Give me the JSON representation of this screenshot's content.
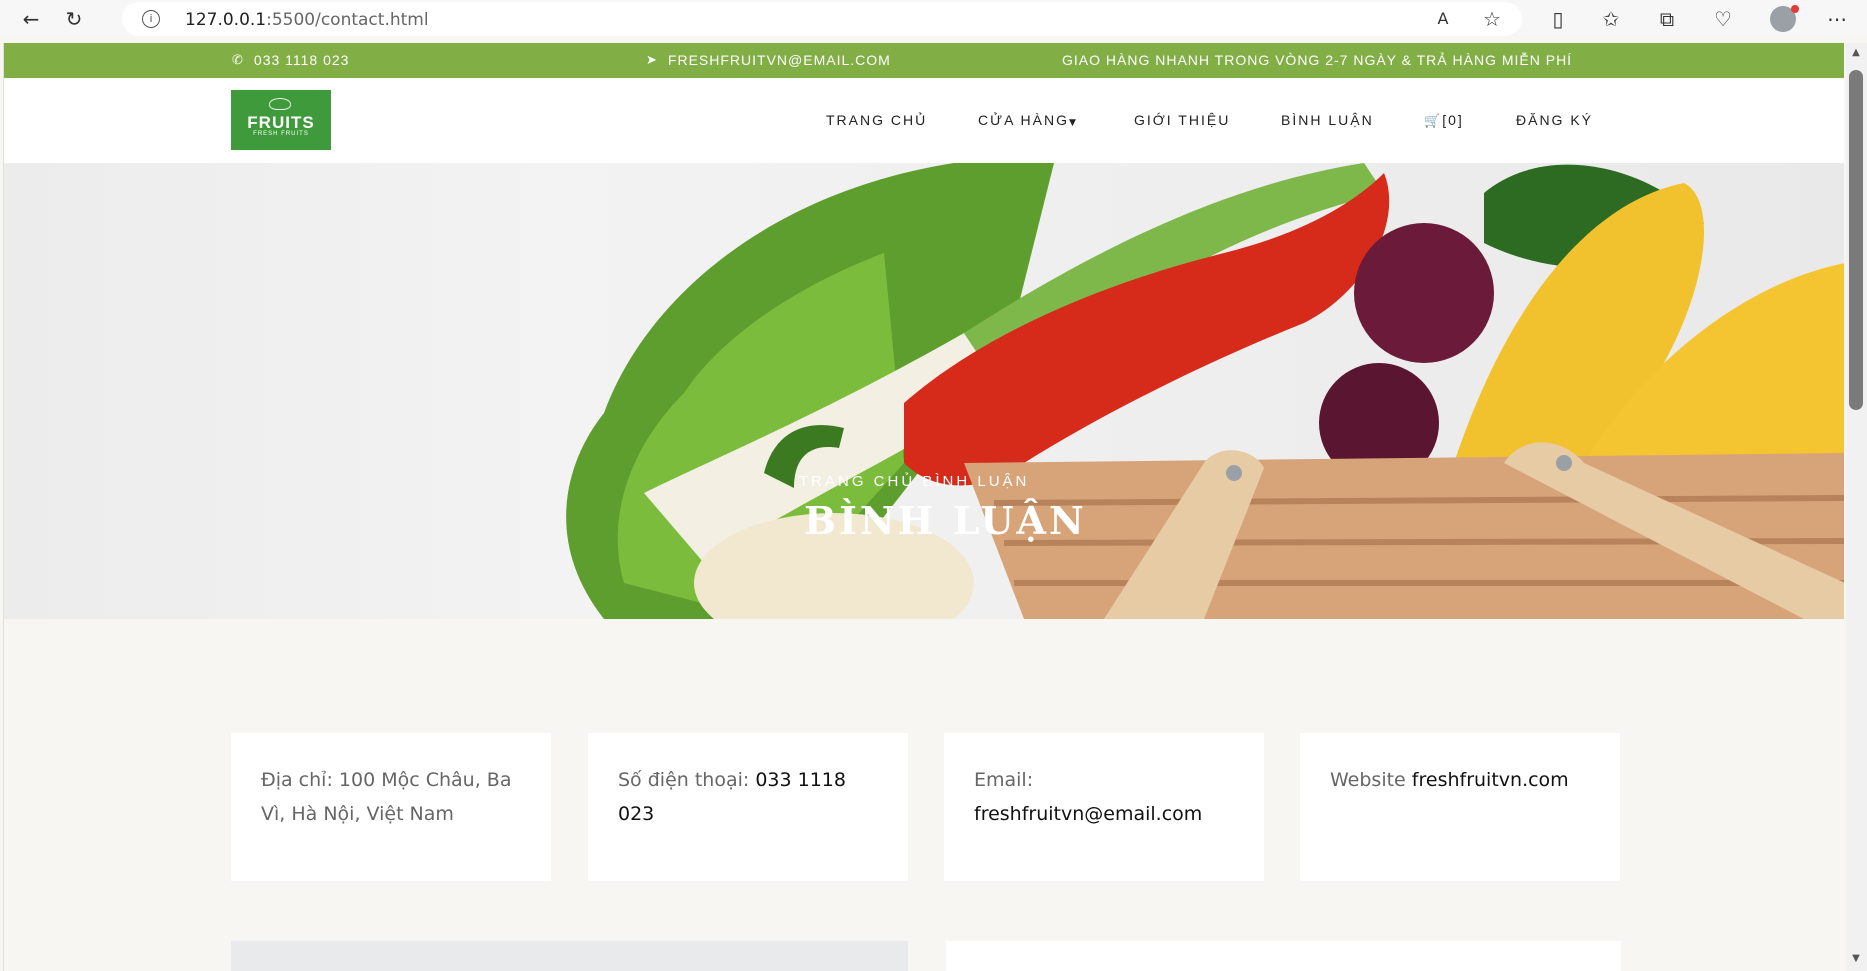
{
  "browser": {
    "url_host": "127.0.0.1",
    "url_rest": ":5500/contact.html"
  },
  "topbar": {
    "phone": "033 1118 023",
    "email": "FRESHFRUITVN@EMAIL.COM",
    "shipping": "GIAO HÀNG NHANH TRONG VÒNG 2-7 NGÀY & TRẢ HÀNG MIỄN PHÍ"
  },
  "logo": {
    "title": "FRUITS",
    "subtitle": "FRESH FRUITS"
  },
  "nav": {
    "home": "TRANG CHỦ",
    "shop": "CỬA HÀNG",
    "about": "GIỚI THIỆU",
    "comments": "BÌNH LUẬN",
    "cart": "[0]",
    "register": "ĐĂNG KÝ"
  },
  "hero": {
    "breadcrumb_home": "TRANG CHỦ",
    "breadcrumb_current": "BÌNH LUẬN",
    "title": "BÌNH LUẬN"
  },
  "cards": {
    "address_label": "Địa chỉ:",
    "address_value": "100 Mộc Châu, Ba Vì, Hà Nội, Việt Nam",
    "phone_label": "Số điện thoại:",
    "phone_value": "033 1118 023",
    "email_label": "Email:",
    "email_value": "freshfruitvn@email.com",
    "website_label": "Website",
    "website_value": "freshfruitvn.com"
  },
  "colors": {
    "brand_green": "#82ae46",
    "logo_green": "#3f9a3c"
  }
}
